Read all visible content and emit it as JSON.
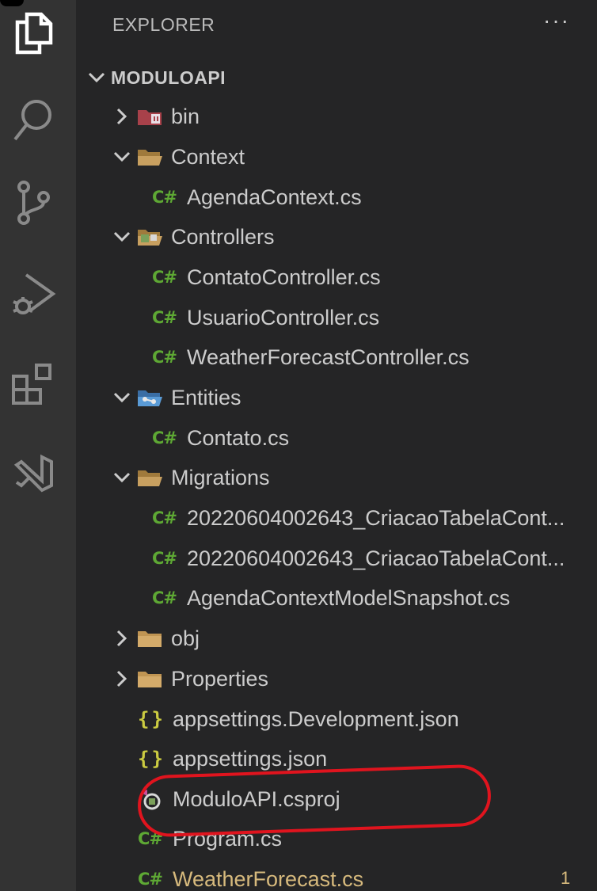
{
  "explorer": {
    "title": "EXPLORER",
    "more": "···",
    "root": "MODULOAPI"
  },
  "activity_bar": [
    "files-icon",
    "search-icon",
    "source-control-icon",
    "run-debug-icon",
    "extensions-icon",
    "visual-studio-icon"
  ],
  "tree": [
    {
      "label": "bin",
      "type": "folder-closed",
      "icon": "bin-folder-icon"
    },
    {
      "label": "Context",
      "type": "folder-open",
      "icon": "folder-open-icon"
    },
    {
      "label": "AgendaContext.cs",
      "type": "cs",
      "icon": "csharp-icon"
    },
    {
      "label": "Controllers",
      "type": "folder-open",
      "icon": "controllers-folder-icon"
    },
    {
      "label": "ContatoController.cs",
      "type": "cs",
      "icon": "csharp-icon"
    },
    {
      "label": "UsuarioController.cs",
      "type": "cs",
      "icon": "csharp-icon"
    },
    {
      "label": "WeatherForecastController.cs",
      "type": "cs",
      "icon": "csharp-icon"
    },
    {
      "label": "Entities",
      "type": "folder-open",
      "icon": "entities-folder-icon"
    },
    {
      "label": "Contato.cs",
      "type": "cs",
      "icon": "csharp-icon"
    },
    {
      "label": "Migrations",
      "type": "folder-open",
      "icon": "folder-open-icon"
    },
    {
      "label": "20220604002643_CriacaoTabelaCont...",
      "type": "cs",
      "icon": "csharp-icon"
    },
    {
      "label": "20220604002643_CriacaoTabelaCont...",
      "type": "cs",
      "icon": "csharp-icon"
    },
    {
      "label": "AgendaContextModelSnapshot.cs",
      "type": "cs",
      "icon": "csharp-icon"
    },
    {
      "label": "obj",
      "type": "folder-closed",
      "icon": "folder-icon"
    },
    {
      "label": "Properties",
      "type": "folder-closed",
      "icon": "folder-icon"
    },
    {
      "label": "appsettings.Development.json",
      "type": "json",
      "icon": "json-icon"
    },
    {
      "label": "appsettings.json",
      "type": "json",
      "icon": "json-icon"
    },
    {
      "label": "ModuloAPI.csproj",
      "type": "csproj",
      "icon": "csproj-icon"
    },
    {
      "label": "Program.cs",
      "type": "cs",
      "icon": "csharp-icon"
    },
    {
      "label": "WeatherForecast.cs",
      "type": "cs",
      "icon": "csharp-icon",
      "badge": "1"
    }
  ],
  "icon_glyphs": {
    "csharp": "C#",
    "json": "{}"
  },
  "colors": {
    "csharp": "#5ea834",
    "json": "#cbcb41",
    "folder": "#c09553",
    "modified": "#d7ba7d",
    "highlight": "#e0141e"
  }
}
